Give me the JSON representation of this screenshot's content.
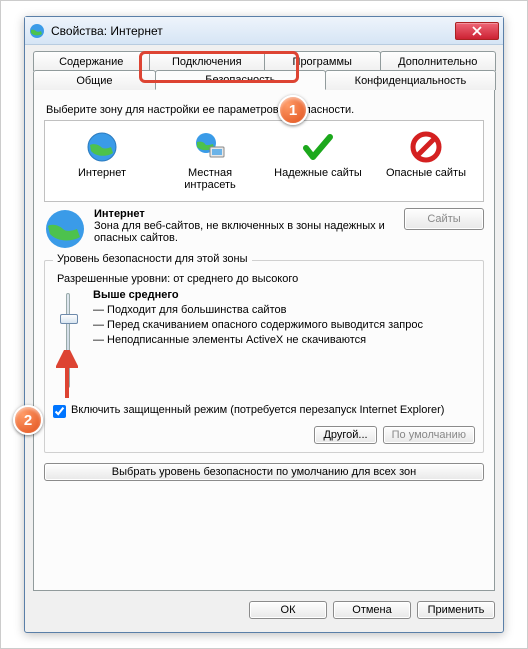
{
  "window": {
    "title": "Свойства: Интернет"
  },
  "tabs": {
    "row1": [
      {
        "label": "Содержание"
      },
      {
        "label": "Подключения"
      },
      {
        "label": "Программы"
      },
      {
        "label": "Дополнительно"
      }
    ],
    "row2": [
      {
        "label": "Общие"
      },
      {
        "label": "Безопасность",
        "active": true
      },
      {
        "label": "Конфиденциальность"
      }
    ]
  },
  "zone_prompt": "Выберите зону для настройки ее параметров безопасности.",
  "zones": [
    {
      "label": "Интернет",
      "icon": "globe"
    },
    {
      "label": "Местная интрасеть",
      "icon": "globe-monitor"
    },
    {
      "label": "Надежные сайты",
      "icon": "check"
    },
    {
      "label": "Опасные сайты",
      "icon": "forbidden"
    }
  ],
  "zone_title": "Интернет",
  "zone_desc": "Зона для веб-сайтов, не включенных в зоны надежных и опасных сайтов.",
  "sites_btn": "Сайты",
  "level_group": "Уровень безопасности для этой зоны",
  "allowed_levels": "Разрешенные уровни: от среднего до высокого",
  "level_name": "Выше среднего",
  "level_lines": [
    "— Подходит для большинства сайтов",
    "— Перед скачиванием опасного содержимого выводится запрос",
    "— Неподписанные элементы ActiveX не скачиваются"
  ],
  "protected_mode": "Включить защищенный режим (потребуется перезапуск Internet Explorer)",
  "custom_btn": "Другой...",
  "default_btn": "По умолчанию",
  "reset_btn": "Выбрать уровень безопасности по умолчанию для всех зон",
  "ok_btn": "ОК",
  "cancel_btn": "Отмена",
  "apply_btn": "Применить",
  "callouts": {
    "one": "1",
    "two": "2"
  }
}
